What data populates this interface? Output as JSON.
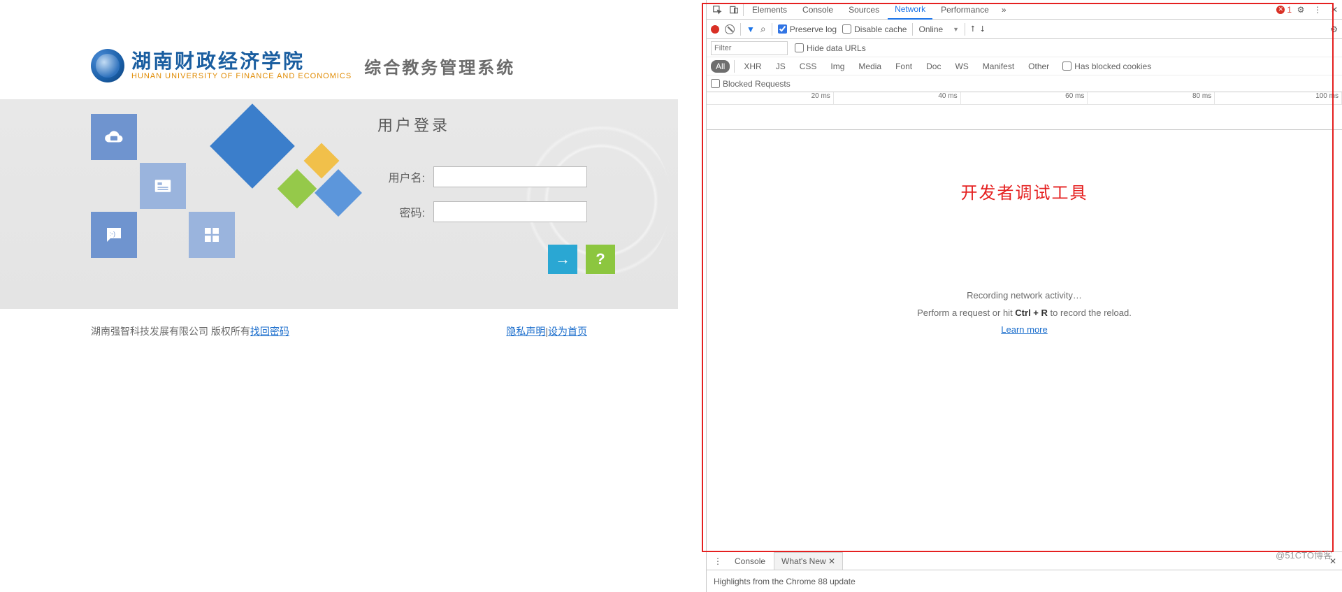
{
  "logo": {
    "school_cn": "湖南财政经济学院",
    "school_en": "HUNAN UNIVERSITY OF FINANCE AND ECONOMICS",
    "system": "综合教务管理系统"
  },
  "login": {
    "title": "用户登录",
    "username_label": "用户名:",
    "password_label": "密码:",
    "username_value": "",
    "password_value": "",
    "arrow_glyph": "→",
    "help_glyph": "?"
  },
  "footer": {
    "copyright": "湖南强智科技发展有限公司 版权所有 ",
    "find_pwd": "找回密码",
    "privacy": "隐私声明",
    "sep": "|",
    "set_home": "设为首页"
  },
  "devtools": {
    "tabs": [
      "Elements",
      "Console",
      "Sources",
      "Network",
      "Performance"
    ],
    "tabs_active": "Network",
    "more_glyph": "»",
    "error_count": "1",
    "toolbar": {
      "funnel": "▼",
      "search": "⌕",
      "preserve_log": "Preserve log",
      "disable_cache": "Disable cache",
      "online": "Online",
      "caret": "▼",
      "upload": "⭡",
      "download": "⭣"
    },
    "filter": {
      "placeholder": "Filter",
      "hide_urls": "Hide data URLs"
    },
    "types": [
      "All",
      "XHR",
      "JS",
      "CSS",
      "Img",
      "Media",
      "Font",
      "Doc",
      "WS",
      "Manifest",
      "Other"
    ],
    "types_active": "All",
    "blocked_cookies": "Has blocked cookies",
    "blocked_requests": "Blocked Requests",
    "timeline_ticks": [
      "20 ms",
      "40 ms",
      "60 ms",
      "80 ms",
      "100 ms"
    ],
    "overlay": "开发者调试工具",
    "rec1": "Recording network activity…",
    "rec2a": "Perform a request or hit ",
    "rec2b": "Ctrl + R",
    "rec2c": " to record the reload.",
    "learn": "Learn more",
    "drawer_tabs": [
      "Console",
      "What's New ✕"
    ],
    "drawer_active": "What's New ✕",
    "drawer_body": "Highlights from the Chrome 88 update",
    "vdots": "⋮",
    "close": "✕",
    "gear": "⚙"
  },
  "watermark": "@51CTO博客"
}
